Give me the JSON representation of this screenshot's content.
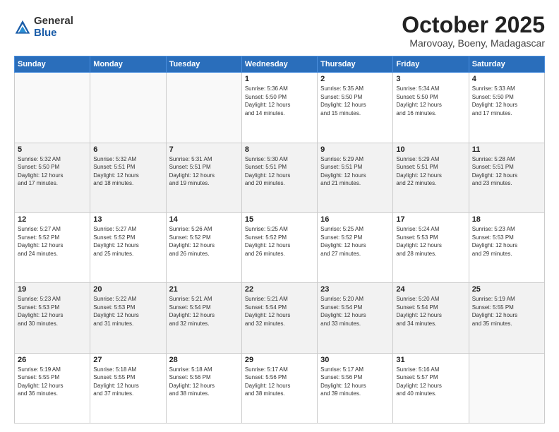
{
  "logo": {
    "general": "General",
    "blue": "Blue"
  },
  "header": {
    "month": "October 2025",
    "location": "Marovoay, Boeny, Madagascar"
  },
  "weekdays": [
    "Sunday",
    "Monday",
    "Tuesday",
    "Wednesday",
    "Thursday",
    "Friday",
    "Saturday"
  ],
  "weeks": [
    [
      {
        "day": "",
        "detail": ""
      },
      {
        "day": "",
        "detail": ""
      },
      {
        "day": "",
        "detail": ""
      },
      {
        "day": "1",
        "detail": "Sunrise: 5:36 AM\nSunset: 5:50 PM\nDaylight: 12 hours\nand 14 minutes."
      },
      {
        "day": "2",
        "detail": "Sunrise: 5:35 AM\nSunset: 5:50 PM\nDaylight: 12 hours\nand 15 minutes."
      },
      {
        "day": "3",
        "detail": "Sunrise: 5:34 AM\nSunset: 5:50 PM\nDaylight: 12 hours\nand 16 minutes."
      },
      {
        "day": "4",
        "detail": "Sunrise: 5:33 AM\nSunset: 5:50 PM\nDaylight: 12 hours\nand 17 minutes."
      }
    ],
    [
      {
        "day": "5",
        "detail": "Sunrise: 5:32 AM\nSunset: 5:50 PM\nDaylight: 12 hours\nand 17 minutes."
      },
      {
        "day": "6",
        "detail": "Sunrise: 5:32 AM\nSunset: 5:51 PM\nDaylight: 12 hours\nand 18 minutes."
      },
      {
        "day": "7",
        "detail": "Sunrise: 5:31 AM\nSunset: 5:51 PM\nDaylight: 12 hours\nand 19 minutes."
      },
      {
        "day": "8",
        "detail": "Sunrise: 5:30 AM\nSunset: 5:51 PM\nDaylight: 12 hours\nand 20 minutes."
      },
      {
        "day": "9",
        "detail": "Sunrise: 5:29 AM\nSunset: 5:51 PM\nDaylight: 12 hours\nand 21 minutes."
      },
      {
        "day": "10",
        "detail": "Sunrise: 5:29 AM\nSunset: 5:51 PM\nDaylight: 12 hours\nand 22 minutes."
      },
      {
        "day": "11",
        "detail": "Sunrise: 5:28 AM\nSunset: 5:51 PM\nDaylight: 12 hours\nand 23 minutes."
      }
    ],
    [
      {
        "day": "12",
        "detail": "Sunrise: 5:27 AM\nSunset: 5:52 PM\nDaylight: 12 hours\nand 24 minutes."
      },
      {
        "day": "13",
        "detail": "Sunrise: 5:27 AM\nSunset: 5:52 PM\nDaylight: 12 hours\nand 25 minutes."
      },
      {
        "day": "14",
        "detail": "Sunrise: 5:26 AM\nSunset: 5:52 PM\nDaylight: 12 hours\nand 26 minutes."
      },
      {
        "day": "15",
        "detail": "Sunrise: 5:25 AM\nSunset: 5:52 PM\nDaylight: 12 hours\nand 26 minutes."
      },
      {
        "day": "16",
        "detail": "Sunrise: 5:25 AM\nSunset: 5:52 PM\nDaylight: 12 hours\nand 27 minutes."
      },
      {
        "day": "17",
        "detail": "Sunrise: 5:24 AM\nSunset: 5:53 PM\nDaylight: 12 hours\nand 28 minutes."
      },
      {
        "day": "18",
        "detail": "Sunrise: 5:23 AM\nSunset: 5:53 PM\nDaylight: 12 hours\nand 29 minutes."
      }
    ],
    [
      {
        "day": "19",
        "detail": "Sunrise: 5:23 AM\nSunset: 5:53 PM\nDaylight: 12 hours\nand 30 minutes."
      },
      {
        "day": "20",
        "detail": "Sunrise: 5:22 AM\nSunset: 5:53 PM\nDaylight: 12 hours\nand 31 minutes."
      },
      {
        "day": "21",
        "detail": "Sunrise: 5:21 AM\nSunset: 5:54 PM\nDaylight: 12 hours\nand 32 minutes."
      },
      {
        "day": "22",
        "detail": "Sunrise: 5:21 AM\nSunset: 5:54 PM\nDaylight: 12 hours\nand 32 minutes."
      },
      {
        "day": "23",
        "detail": "Sunrise: 5:20 AM\nSunset: 5:54 PM\nDaylight: 12 hours\nand 33 minutes."
      },
      {
        "day": "24",
        "detail": "Sunrise: 5:20 AM\nSunset: 5:54 PM\nDaylight: 12 hours\nand 34 minutes."
      },
      {
        "day": "25",
        "detail": "Sunrise: 5:19 AM\nSunset: 5:55 PM\nDaylight: 12 hours\nand 35 minutes."
      }
    ],
    [
      {
        "day": "26",
        "detail": "Sunrise: 5:19 AM\nSunset: 5:55 PM\nDaylight: 12 hours\nand 36 minutes."
      },
      {
        "day": "27",
        "detail": "Sunrise: 5:18 AM\nSunset: 5:55 PM\nDaylight: 12 hours\nand 37 minutes."
      },
      {
        "day": "28",
        "detail": "Sunrise: 5:18 AM\nSunset: 5:56 PM\nDaylight: 12 hours\nand 38 minutes."
      },
      {
        "day": "29",
        "detail": "Sunrise: 5:17 AM\nSunset: 5:56 PM\nDaylight: 12 hours\nand 38 minutes."
      },
      {
        "day": "30",
        "detail": "Sunrise: 5:17 AM\nSunset: 5:56 PM\nDaylight: 12 hours\nand 39 minutes."
      },
      {
        "day": "31",
        "detail": "Sunrise: 5:16 AM\nSunset: 5:57 PM\nDaylight: 12 hours\nand 40 minutes."
      },
      {
        "day": "",
        "detail": ""
      }
    ]
  ]
}
